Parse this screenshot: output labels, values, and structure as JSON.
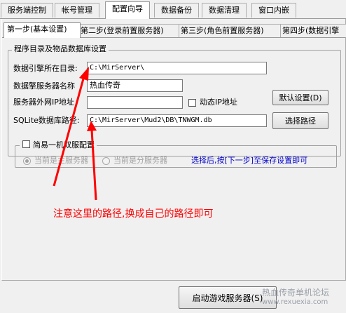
{
  "top_tabs": [
    {
      "label": "服务端控制",
      "active": false
    },
    {
      "label": "帐号管理",
      "active": false
    },
    {
      "label": "配置向导",
      "active": true
    },
    {
      "label": "数据备份",
      "active": false
    },
    {
      "label": "数据清理",
      "active": false
    },
    {
      "label": "窗口内嵌",
      "active": false
    }
  ],
  "sub_tabs": [
    {
      "label": "第一步(基本设置)",
      "active": true
    },
    {
      "label": "第二步(登录前置服务器)",
      "active": false
    },
    {
      "label": "第三步(角色前置服务器)",
      "active": false
    },
    {
      "label": "第四步(数据引擎",
      "active": false
    }
  ],
  "group": {
    "title": "程序目录及物品数据库设置",
    "engine_dir_label": "数据引擎所在目录:",
    "engine_dir_value": "C:\\MirServer\\",
    "server_name_label": "数据擎服务器名称",
    "server_name_value": "热血传奇",
    "public_ip_label": "服务器外网IP地址",
    "public_ip_value": "",
    "dynamic_ip_label": "动态IP地址",
    "dynamic_ip_checked": false,
    "default_button_label": "默认设置(D)",
    "sqlite_label": "SQLite数据库路径:",
    "sqlite_value": "C:\\MirServer\\Mud2\\DB\\TNWGM.db",
    "browse_button_label": "选择路径"
  },
  "dual_server": {
    "checkbox_label": "简易一机双服配置",
    "checked": false,
    "radio_main_label": "当前是主服务器",
    "radio_main_selected": true,
    "radio_sub_label": "当前是分服务器",
    "radio_sub_selected": false,
    "hint": "选择后,按[下一步]至保存设置即可"
  },
  "annotation": {
    "text": "注意这里的路径,换成自己的路径即可",
    "color": "#ff0000"
  },
  "start_button_label": "启动游戏服务器(S)",
  "watermark": {
    "line1": "热血传奇单机论坛",
    "line2": "www.rexuexia.com"
  }
}
